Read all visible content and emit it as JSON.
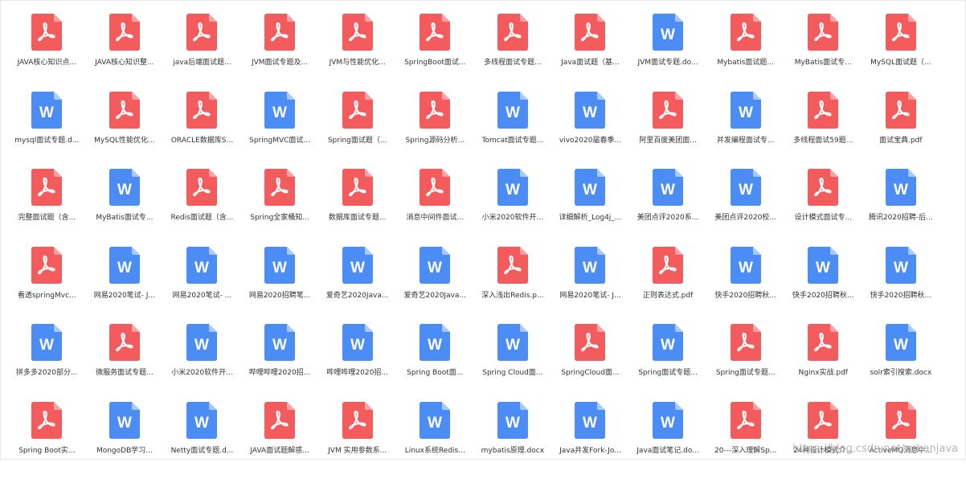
{
  "colors": {
    "pdf": "#f35b5d",
    "pdf_fold": "#f9a2a3",
    "doc": "#4b8df5",
    "doc_fold": "#a9c8fb"
  },
  "watermark": "https://blog.csdn.net/zubanjava",
  "files": [
    {
      "name": "JAVA核心知识点...",
      "type": "pdf",
      "icon": "pdf-icon"
    },
    {
      "name": "JAVA核心知识整...",
      "type": "pdf",
      "icon": "pdf-icon"
    },
    {
      "name": "java后端面试题...",
      "type": "pdf",
      "icon": "pdf-icon"
    },
    {
      "name": "JVM面试专题及...",
      "type": "pdf",
      "icon": "pdf-icon"
    },
    {
      "name": "JVM与性能优化...",
      "type": "pdf",
      "icon": "pdf-icon"
    },
    {
      "name": "SpringBoot面试...",
      "type": "pdf",
      "icon": "pdf-icon"
    },
    {
      "name": "多线程面试专题...",
      "type": "pdf",
      "icon": "pdf-icon"
    },
    {
      "name": "Java面试题（基...",
      "type": "pdf",
      "icon": "pdf-icon"
    },
    {
      "name": "JVM面试专题.do...",
      "type": "doc",
      "icon": "word-icon"
    },
    {
      "name": "Mybatis面试题...",
      "type": "pdf",
      "icon": "pdf-icon"
    },
    {
      "name": "MyBatis面试专...",
      "type": "pdf",
      "icon": "pdf-icon"
    },
    {
      "name": "MySQL面试题（...",
      "type": "pdf",
      "icon": "pdf-icon"
    },
    {
      "name": "mysql面试专题.d...",
      "type": "doc",
      "icon": "word-icon"
    },
    {
      "name": "MySQL性能优化...",
      "type": "pdf",
      "icon": "pdf-icon"
    },
    {
      "name": "ORACLE数据库S...",
      "type": "pdf",
      "icon": "pdf-icon"
    },
    {
      "name": "SpringMVC面试...",
      "type": "doc",
      "icon": "word-icon"
    },
    {
      "name": "Spring面试题（...",
      "type": "pdf",
      "icon": "pdf-icon"
    },
    {
      "name": "Spring源码分析...",
      "type": "pdf",
      "icon": "pdf-icon"
    },
    {
      "name": "Tomcat面试专题...",
      "type": "doc",
      "icon": "word-icon"
    },
    {
      "name": "vivo2020届春季...",
      "type": "doc",
      "icon": "word-icon"
    },
    {
      "name": "阿里百度美团面...",
      "type": "pdf",
      "icon": "pdf-icon"
    },
    {
      "name": "并发编程面试专...",
      "type": "doc",
      "icon": "word-icon"
    },
    {
      "name": "多线程面试59题...",
      "type": "pdf",
      "icon": "pdf-icon"
    },
    {
      "name": "面试宝典.pdf",
      "type": "pdf",
      "icon": "pdf-icon"
    },
    {
      "name": "完整面试题（含...",
      "type": "pdf",
      "icon": "pdf-icon"
    },
    {
      "name": "MyBatis面试专...",
      "type": "doc",
      "icon": "word-icon"
    },
    {
      "name": "Redis面试题（含...",
      "type": "pdf",
      "icon": "pdf-icon"
    },
    {
      "name": "Spring全家桶知...",
      "type": "pdf",
      "icon": "pdf-icon"
    },
    {
      "name": "数据库面试专题...",
      "type": "pdf",
      "icon": "pdf-icon"
    },
    {
      "name": "消息中间件面试...",
      "type": "pdf",
      "icon": "pdf-icon"
    },
    {
      "name": "小米2020软件开...",
      "type": "doc",
      "icon": "word-icon"
    },
    {
      "name": "详细解析_Log4j_...",
      "type": "doc",
      "icon": "word-icon"
    },
    {
      "name": "美团点评2020系...",
      "type": "doc",
      "icon": "word-icon"
    },
    {
      "name": "美团点评2020校...",
      "type": "doc",
      "icon": "word-icon"
    },
    {
      "name": "设计模式面试专...",
      "type": "pdf",
      "icon": "pdf-icon"
    },
    {
      "name": "腾讯2020招聘-后...",
      "type": "doc",
      "icon": "word-icon"
    },
    {
      "name": "看透springMvc...",
      "type": "pdf",
      "icon": "pdf-icon"
    },
    {
      "name": "网易2020笔试- J...",
      "type": "doc",
      "icon": "word-icon"
    },
    {
      "name": "网易2020笔试- ...",
      "type": "doc",
      "icon": "word-icon"
    },
    {
      "name": "网易2020招聘笔...",
      "type": "doc",
      "icon": "word-icon"
    },
    {
      "name": "爱奇艺2020Java...",
      "type": "doc",
      "icon": "word-icon"
    },
    {
      "name": "爱奇艺2020Java...",
      "type": "doc",
      "icon": "word-icon"
    },
    {
      "name": "深入浅出Redis.p...",
      "type": "pdf",
      "icon": "pdf-icon"
    },
    {
      "name": "网易2020笔试- J...",
      "type": "doc",
      "icon": "word-icon"
    },
    {
      "name": "正则表达式.pdf",
      "type": "pdf",
      "icon": "pdf-icon"
    },
    {
      "name": "快手2020招聘秋...",
      "type": "doc",
      "icon": "word-icon"
    },
    {
      "name": "快手2020招聘秋...",
      "type": "doc",
      "icon": "word-icon"
    },
    {
      "name": "快手2020招聘秋...",
      "type": "doc",
      "icon": "word-icon"
    },
    {
      "name": "拼多多2020部分...",
      "type": "doc",
      "icon": "word-icon"
    },
    {
      "name": "微服务面试专题...",
      "type": "pdf",
      "icon": "pdf-icon"
    },
    {
      "name": "小米2020软件开...",
      "type": "doc",
      "icon": "word-icon"
    },
    {
      "name": "哔哩哔哩2020招...",
      "type": "doc",
      "icon": "word-icon"
    },
    {
      "name": "哔哩哔哩2020招...",
      "type": "doc",
      "icon": "word-icon"
    },
    {
      "name": "Spring Boot面...",
      "type": "doc",
      "icon": "word-icon"
    },
    {
      "name": "Spring Cloud面...",
      "type": "doc",
      "icon": "word-icon"
    },
    {
      "name": "SpringCloud面...",
      "type": "pdf",
      "icon": "pdf-icon"
    },
    {
      "name": "Spring面试专题...",
      "type": "doc",
      "icon": "word-icon"
    },
    {
      "name": "Spring面试专题...",
      "type": "pdf",
      "icon": "pdf-icon"
    },
    {
      "name": "Nginx实战.pdf",
      "type": "pdf",
      "icon": "pdf-icon"
    },
    {
      "name": "solr索引搜索.docx",
      "type": "doc",
      "icon": "word-icon"
    },
    {
      "name": "Spring Boot实...",
      "type": "pdf",
      "icon": "pdf-icon"
    },
    {
      "name": "MongoDB学习...",
      "type": "doc",
      "icon": "word-icon"
    },
    {
      "name": "Netty面试专题.d...",
      "type": "doc",
      "icon": "word-icon"
    },
    {
      "name": "JAVA面试题解惑...",
      "type": "pdf",
      "icon": "pdf-icon"
    },
    {
      "name": "JVM 实用参数系...",
      "type": "pdf",
      "icon": "pdf-icon"
    },
    {
      "name": "Linux系统Redis...",
      "type": "doc",
      "icon": "word-icon"
    },
    {
      "name": "mybatis原理.docx",
      "type": "doc",
      "icon": "word-icon"
    },
    {
      "name": "Java并发Fork-Jo...",
      "type": "doc",
      "icon": "word-icon"
    },
    {
      "name": "Java面试笔记.do...",
      "type": "doc",
      "icon": "word-icon"
    },
    {
      "name": "20---深入理解Sp...",
      "type": "pdf",
      "icon": "pdf-icon"
    },
    {
      "name": "24种设计模式介...",
      "type": "pdf",
      "icon": "pdf-icon"
    },
    {
      "name": "ActiveMQ消息中...",
      "type": "pdf",
      "icon": "pdf-icon"
    }
  ]
}
